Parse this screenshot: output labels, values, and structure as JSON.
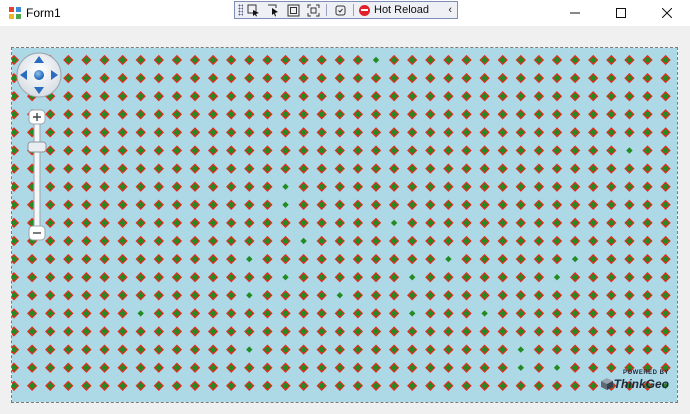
{
  "window": {
    "title": "Form1",
    "minimize_icon": "minimize-icon",
    "maximize_icon": "maximize-icon",
    "close_icon": "close-icon"
  },
  "debug_toolbar": {
    "hot_reload_label": "Hot Reload",
    "tools": [
      "select-element-icon",
      "live-visual-tree-icon",
      "display-layout-icon",
      "track-focus-icon",
      "binding-failures-icon"
    ]
  },
  "map": {
    "background_color": "#add8e6",
    "marker_fill": "#228b22",
    "marker_stroke": "#e8291c",
    "logo_powered_by": "POWERED BY",
    "logo_name": "ThinkGeo",
    "pan_control_icon": "pan-control-icon",
    "zoom_in_icon": "zoom-in-icon",
    "zoom_out_icon": "zoom-out-icon"
  }
}
